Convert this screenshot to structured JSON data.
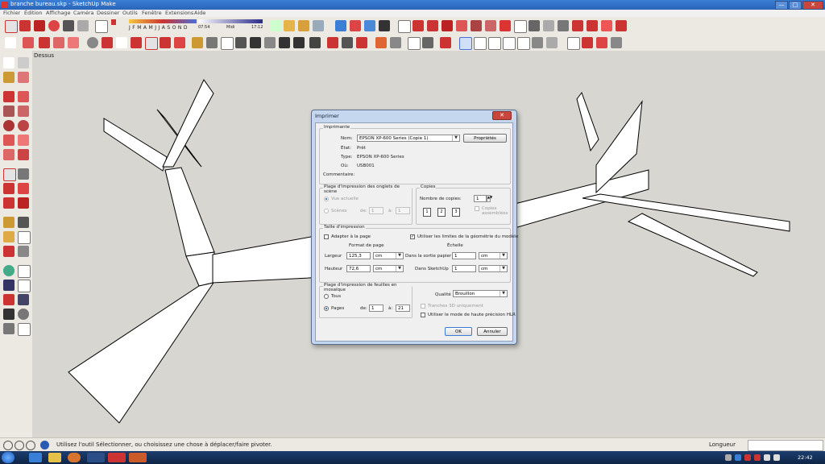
{
  "window": {
    "title": "branche bureau.skp - SketchUp Make",
    "min": "—",
    "max": "□",
    "close": "✕"
  },
  "menu": [
    "Fichier",
    "Édition",
    "Affichage",
    "Caméra",
    "Dessiner",
    "Outils",
    "Fenêtre",
    "Extensions",
    "Aide"
  ],
  "shadow_bar": {
    "months": "J F M A M J J A S O N D",
    "time_start": "07:54",
    "midday": "Midi",
    "time_end": "17:12"
  },
  "scene_label": "Dessus",
  "status": {
    "message": "Utilisez l'outil Sélectionner, ou choisissez une chose à déplacer/faire pivoter.",
    "measure_label": "Longueur",
    "measure_value": ""
  },
  "taskbar": {
    "clock": "22:42"
  },
  "dialog": {
    "title": "Imprimer",
    "close": "✕",
    "printer": {
      "group": "Imprimante",
      "name_label": "Nom:",
      "name_value": "EPSON XP-600 Series (Copie 1)",
      "properties": "Propriétés",
      "state_label": "État:",
      "state_value": "Prêt",
      "type_label": "Type:",
      "type_value": "EPSON XP-600 Series",
      "where_label": "Où:",
      "where_value": "USB001",
      "comment_label": "Commentaire:"
    },
    "scenes": {
      "group": "Plage d'impression des onglets de scène",
      "current": "Vue actuelle",
      "pages": "Scènes",
      "from": "de:",
      "from_value": "1",
      "to": "à:",
      "to_value": "1"
    },
    "copies": {
      "group": "Copies",
      "count_label": "Nombre de copies:",
      "count_value": "1",
      "collate": "Copies assemblées"
    },
    "print_size": {
      "group": "Taille d'impression",
      "fit": "Adapter à la page",
      "use_extents": "Utiliser les limites de la géométrie du modèle",
      "page_format": "Format de page",
      "scale": "Échelle",
      "width_label": "Largeur",
      "width_value": "125,3",
      "width_unit": "cm",
      "height_label": "Hauteur",
      "height_value": "72,6",
      "height_unit": "cm",
      "paper_label": "Dans la sortie papier",
      "paper_value": "1",
      "paper_unit": "cm",
      "sketchup_label": "Dans SketchUp",
      "sketchup_value": "1",
      "sketchup_unit": "cm"
    },
    "tiles": {
      "group": "Plage d'impression de feuilles en mosaïque",
      "all": "Tous",
      "pages": "Pages",
      "from": "de:",
      "from_value": "1",
      "to": "à:",
      "to_value": "21"
    },
    "quality_label": "Qualité",
    "quality_value": "Brouillon",
    "lines_3d": "Tranches 3D uniquement",
    "hires": "Utiliser le mode de haute précision HLR",
    "ok": "OK",
    "cancel": "Annuler"
  }
}
